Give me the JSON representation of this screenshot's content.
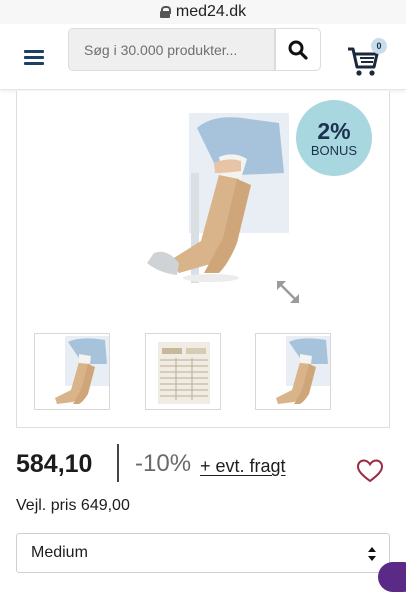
{
  "browser": {
    "url": "med24.dk"
  },
  "header": {
    "search_placeholder": "Søg i 30.000 produkter...",
    "cart_count": "0"
  },
  "gallery": {
    "bonus_percent": "2%",
    "bonus_label": "BONUS",
    "thumbnails": [
      "product-photo",
      "size-chart",
      "product-photo"
    ]
  },
  "product": {
    "price": "584,10",
    "discount": "-10%",
    "shipping_link": "+ evt. fragt",
    "rrp": "Vejl. pris 649,00",
    "selected_size": "Medium"
  },
  "colors": {
    "brand_navy": "#1b4163",
    "bonus_badge": "#a9d7df",
    "heart": "#9b2a45"
  }
}
